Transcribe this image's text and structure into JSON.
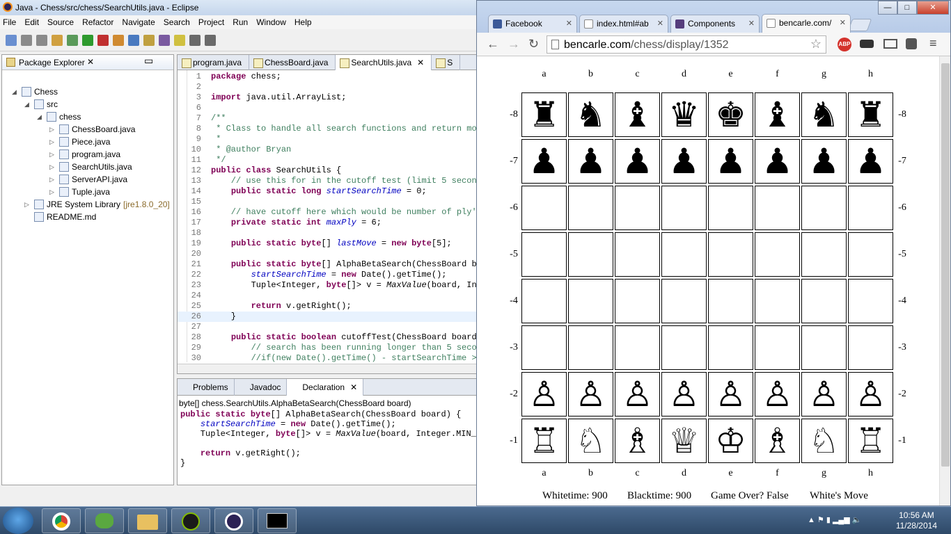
{
  "eclipse": {
    "title": "Java - Chess/src/chess/SearchUtils.java - Eclipse",
    "menu": [
      "File",
      "Edit",
      "Source",
      "Refactor",
      "Navigate",
      "Search",
      "Project",
      "Run",
      "Window",
      "Help"
    ],
    "package_explorer": {
      "title": "Package Explorer",
      "items": [
        {
          "label": "Chess",
          "depth": 0
        },
        {
          "label": "src",
          "depth": 1
        },
        {
          "label": "chess",
          "depth": 2
        },
        {
          "label": "ChessBoard.java",
          "depth": 3
        },
        {
          "label": "Piece.java",
          "depth": 3
        },
        {
          "label": "program.java",
          "depth": 3
        },
        {
          "label": "SearchUtils.java",
          "depth": 3
        },
        {
          "label": "ServerAPI.java",
          "depth": 3
        },
        {
          "label": "Tuple.java",
          "depth": 3
        },
        {
          "label": "JRE System Library",
          "depth": 1,
          "suffix": "[jre1.8.0_20]"
        },
        {
          "label": "README.md",
          "depth": 1
        }
      ]
    },
    "editor_tabs": [
      "program.java",
      "ChessBoard.java",
      "SearchUtils.java",
      "S"
    ],
    "code_lines": [
      {
        "n": "1",
        "t": "package chess;"
      },
      {
        "n": "2",
        "t": ""
      },
      {
        "n": "3",
        "t": "import java.util.ArrayList;"
      },
      {
        "n": "6",
        "t": ""
      },
      {
        "n": "7",
        "t": "/**"
      },
      {
        "n": "8",
        "t": " * Class to handle all search functions and return move"
      },
      {
        "n": "9",
        "t": " *"
      },
      {
        "n": "10",
        "t": " * @author Bryan"
      },
      {
        "n": "11",
        "t": " */"
      },
      {
        "n": "12",
        "t": "public class SearchUtils {"
      },
      {
        "n": "13",
        "t": "    // use this for in the cutoff test (limit 5 seconds"
      },
      {
        "n": "14",
        "t": "    public static long startSearchTime = 0;"
      },
      {
        "n": "15",
        "t": ""
      },
      {
        "n": "16",
        "t": "    // have cutoff here which would be number of ply's"
      },
      {
        "n": "17",
        "t": "    private static int maxPly = 6;"
      },
      {
        "n": "18",
        "t": ""
      },
      {
        "n": "19",
        "t": "    public static byte[] lastMove = new byte[5];"
      },
      {
        "n": "20",
        "t": ""
      },
      {
        "n": "21",
        "t": "    public static byte[] AlphaBetaSearch(ChessBoard boa"
      },
      {
        "n": "22",
        "t": "        startSearchTime = new Date().getTime();"
      },
      {
        "n": "23",
        "t": "        Tuple<Integer, byte[]> v = MaxValue(board, Inte"
      },
      {
        "n": "24",
        "t": ""
      },
      {
        "n": "25",
        "t": "        return v.getRight();"
      },
      {
        "n": "26",
        "t": "    }"
      },
      {
        "n": "27",
        "t": ""
      },
      {
        "n": "28",
        "t": "    public static boolean cutoffTest(ChessBoard board,"
      },
      {
        "n": "29",
        "t": "        // search has been running longer than 5 second"
      },
      {
        "n": "30",
        "t": "        //if(new Date().getTime() - startSearchTime > 5"
      }
    ],
    "bottom_tabs": [
      "Problems",
      "Javadoc",
      "Declaration"
    ],
    "declaration_sig": "byte[] chess.SearchUtils.AlphaBetaSearch(ChessBoard board)",
    "declaration_code": [
      "public static byte[] AlphaBetaSearch(ChessBoard board) {",
      "    startSearchTime = new Date().getTime();",
      "    Tuple<Integer, byte[]> v = MaxValue(board, Integer.MIN_VA",
      "",
      "    return v.getRight();",
      "}"
    ]
  },
  "chrome": {
    "tabs": [
      "Facebook",
      "index.html#ab",
      "Components",
      "bencarle.com/"
    ],
    "url_host": "bencarle.com",
    "url_path": "/chess/display/1352",
    "files": [
      "a",
      "b",
      "c",
      "d",
      "e",
      "f",
      "g",
      "h"
    ],
    "ranks": [
      "-8",
      "-7",
      "-6",
      "-5",
      "-4",
      "-3",
      "-2",
      "-1"
    ],
    "board": [
      [
        "♜",
        "♞",
        "♝",
        "♛",
        "♚",
        "♝",
        "♞",
        "♜"
      ],
      [
        "♟",
        "♟",
        "♟",
        "♟",
        "♟",
        "♟",
        "♟",
        "♟"
      ],
      [
        "",
        "",
        "",
        "",
        "",
        "",
        "",
        ""
      ],
      [
        "",
        "",
        "",
        "",
        "",
        "",
        "",
        ""
      ],
      [
        "",
        "",
        "",
        "",
        "",
        "",
        "",
        ""
      ],
      [
        "",
        "",
        "",
        "",
        "",
        "",
        "",
        ""
      ],
      [
        "♙",
        "♙",
        "♙",
        "♙",
        "♙",
        "♙",
        "♙",
        "♙"
      ],
      [
        "♖",
        "♘",
        "♗",
        "♕",
        "♔",
        "♗",
        "♘",
        "♖"
      ]
    ],
    "status": {
      "whitetime": "Whitetime: 900",
      "blacktime": "Blacktime: 900",
      "gameover": "Game Over? False",
      "turn": "White's Move"
    }
  },
  "taskbar": {
    "time": "10:56 AM",
    "date": "11/28/2014"
  }
}
